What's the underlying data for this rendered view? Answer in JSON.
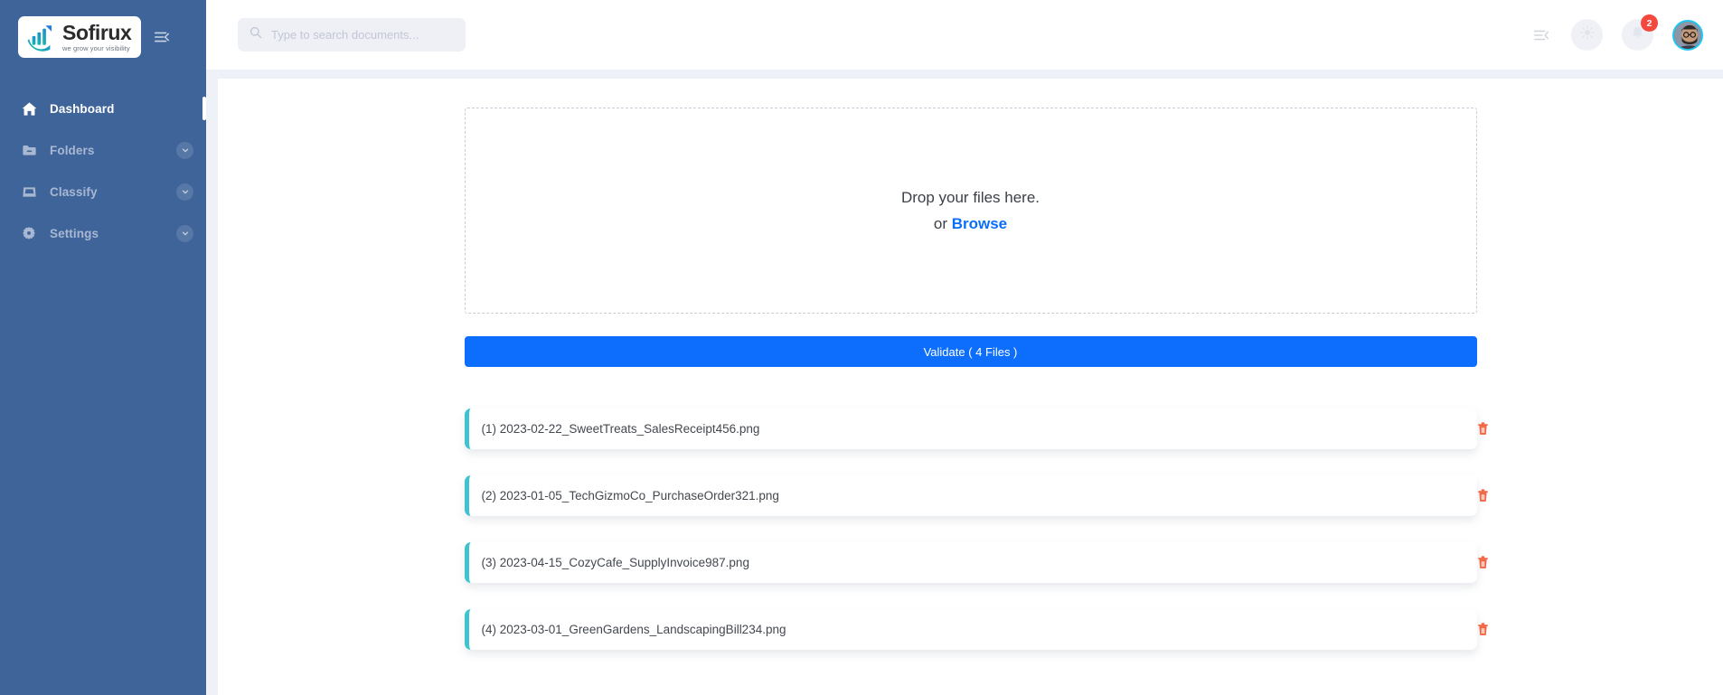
{
  "brand": {
    "name": "Sofirux",
    "tagline": "we grow your visibility",
    "logo_icon": "bar-chart-arrow-icon",
    "accent_teal": "#3fc3cf",
    "sidebar_blue": "#3f6499",
    "primary_blue": "#0d6efd"
  },
  "sidebar": {
    "toggle_icon": "collapse-menu-icon",
    "items": [
      {
        "label": "Dashboard",
        "icon": "home-icon",
        "active": true,
        "has_caret": false
      },
      {
        "label": "Folders",
        "icon": "folder-icon",
        "active": false,
        "has_caret": true
      },
      {
        "label": "Classify",
        "icon": "inbox-icon",
        "active": false,
        "has_caret": true
      },
      {
        "label": "Settings",
        "icon": "gear-icon",
        "active": false,
        "has_caret": true
      }
    ]
  },
  "topbar": {
    "search": {
      "placeholder": "Type to search documents...",
      "value": "",
      "icon": "search-icon"
    },
    "collapse_icon": "collapse-menu-icon",
    "theme_icon": "sun-icon",
    "notifications": {
      "icon": "bell-icon",
      "count": "2",
      "badge_color": "#f4483f"
    },
    "avatar_icon": "user-avatar"
  },
  "dropzone": {
    "line1": "Drop your files here.",
    "or_text": "or ",
    "browse_label": "Browse"
  },
  "validate": {
    "label": "Validate ( 4 Files )"
  },
  "files": {
    "delete_icon": "trash-icon",
    "items": [
      {
        "name": "(1) 2023-02-22_SweetTreats_SalesReceipt456.png"
      },
      {
        "name": "(2) 2023-01-05_TechGizmoCo_PurchaseOrder321.png"
      },
      {
        "name": "(3) 2023-04-15_CozyCafe_SupplyInvoice987.png"
      },
      {
        "name": "(4) 2023-03-01_GreenGardens_LandscapingBill234.png"
      }
    ]
  }
}
